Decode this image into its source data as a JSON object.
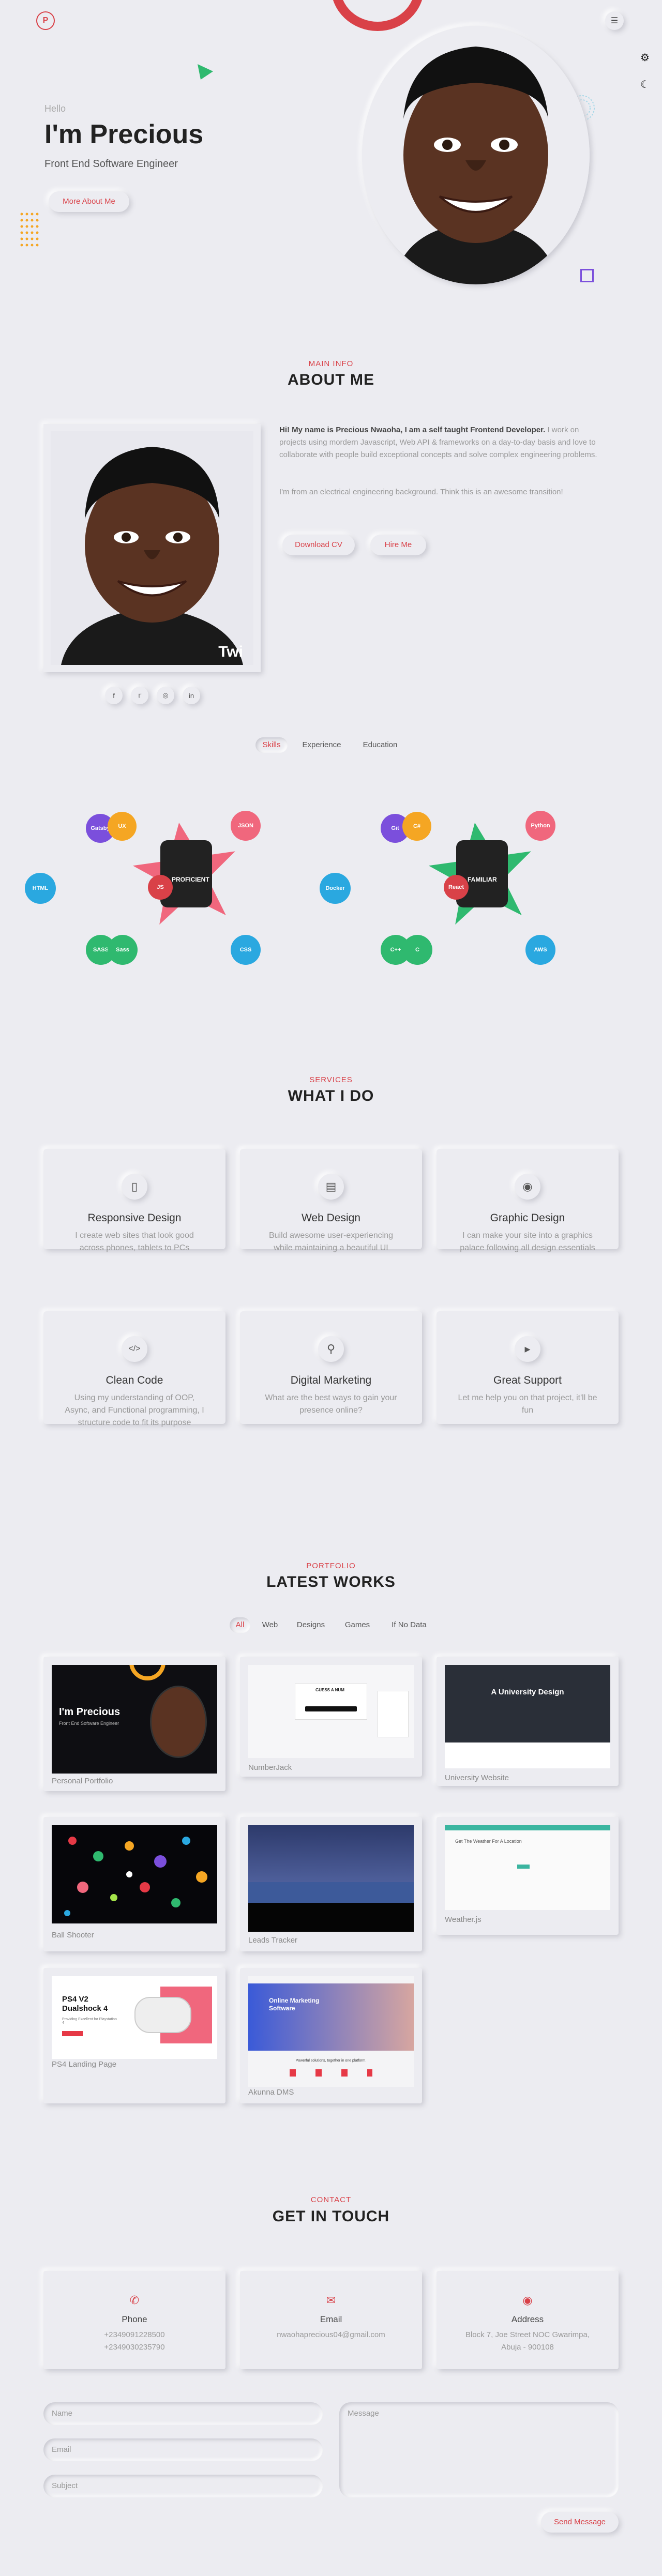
{
  "nav": {
    "logo": "P",
    "menu_icon": "menu-icon",
    "settings_icon": "gear-icon",
    "theme_icon": "moon-icon"
  },
  "hero": {
    "greeting": "Hello",
    "name": "I'm Precious",
    "role": "Front End Software Engineer",
    "more_button": "More About Me"
  },
  "about": {
    "subtitle": "MAIN INFO",
    "title": "ABOUT ME",
    "bio_bold": "Hi! My name is Precious Nwaoha, I am a self taught Frontend Developer.",
    "bio_rest": " I work on projects using mordern Javascript, Web API & frameworks on a day-to-day basis and love to collaborate with people build exceptional concepts and solve complex engineering problems.",
    "bio_extra": "I'm from an electrical engineering background. Think this is an awesome transition!",
    "download_button": "Download CV",
    "hire_button": "Hire Me",
    "photo_badge": "Twi",
    "socials": [
      "facebook-icon",
      "twitter-icon",
      "instagram-icon",
      "linkedin-icon"
    ]
  },
  "skills": {
    "tabs": [
      "Skills",
      "Experience",
      "Education"
    ],
    "active_tab": "Skills",
    "left": {
      "center_label": "PROFICIENT",
      "center_badge": "JS",
      "bubbles": [
        "Gatsby",
        "UX",
        "JSON",
        "HTML",
        "SASS",
        "Sass",
        "CSS"
      ]
    },
    "right": {
      "center_label": "FAMILIAR",
      "center_badge": "React",
      "bubbles": [
        "Git",
        "C#",
        "Python",
        "Docker",
        "C++",
        "C",
        "AWS"
      ]
    }
  },
  "services": {
    "subtitle": "SERVICES",
    "title": "WHAT I DO",
    "items": [
      {
        "icon": "mobile-icon",
        "title": "Responsive Design",
        "text": "I create web sites that look good across phones, tablets to PCs"
      },
      {
        "icon": "desktop-icon",
        "title": "Web Design",
        "text": "Build awesome user-experiencing while maintaining a beautiful UI"
      },
      {
        "icon": "palette-icon",
        "title": "Graphic Design",
        "text": "I can make your site into a graphics palace following all design essentials"
      },
      {
        "icon": "code-icon",
        "title": "Clean Code",
        "text": "Using my understanding of OOP, Async, and Functional programming, I structure code to fit its purpose"
      },
      {
        "icon": "search-icon",
        "title": "Digital Marketing",
        "text": "What are the best ways to gain your presence online?"
      },
      {
        "icon": "megaphone-icon",
        "title": "Great Support",
        "text": "Let me help you on that project, it'll be fun"
      }
    ]
  },
  "portfolio": {
    "subtitle": "PORTFOLIO",
    "title": "LATEST WORKS",
    "filters": [
      "All",
      "Web",
      "Designs",
      "Games",
      "If No Data"
    ],
    "active_filter": "All",
    "works": [
      {
        "label": "Personal Portfolio",
        "thumb_title": "I'm Precious",
        "thumb_sub": "Front End Software Engineer"
      },
      {
        "label": "NumberJack",
        "thumb_title": "GUESS A NUM"
      },
      {
        "label": "University Website",
        "thumb_title": "A University Design"
      },
      {
        "label": "Ball Shooter"
      },
      {
        "label": "Leads Tracker"
      },
      {
        "label": "Weather.js",
        "thumb_title": "Get The Weather For A Location"
      },
      {
        "label": "PS4 Landing Page",
        "thumb_title": "PS4 V2 Dualshock 4",
        "thumb_sub": "Providing Excellent for Playstation 4"
      },
      {
        "label": "Akunna DMS",
        "thumb_title": "Online Marketing Software",
        "thumb_sub": "Powerful solutions, together in one platform."
      }
    ]
  },
  "contact": {
    "subtitle": "CONTACT",
    "title": "GET IN TOUCH",
    "cards": [
      {
        "icon": "phone-icon",
        "title": "Phone",
        "lines": [
          "+2349091228500",
          "+2349030235790"
        ]
      },
      {
        "icon": "envelope-icon",
        "title": "Email",
        "lines": [
          "nwaohaprecious04@gmail.com"
        ]
      },
      {
        "icon": "location-icon",
        "title": "Address",
        "lines": [
          "Block 7, Joe Street NOC Gwarimpa, Abuja - 900108"
        ]
      }
    ],
    "form": {
      "name_placeholder": "Name",
      "email_placeholder": "Email",
      "subject_placeholder": "Subject",
      "message_placeholder": "Message",
      "send_button": "Send Message"
    }
  },
  "colors": {
    "accent": "#d94148",
    "background": "#ececf1",
    "pink": "#f0677d",
    "green": "#2fb96f",
    "blue": "#2aa8e0",
    "purple": "#7b4fdc",
    "orange": "#f5a623"
  }
}
